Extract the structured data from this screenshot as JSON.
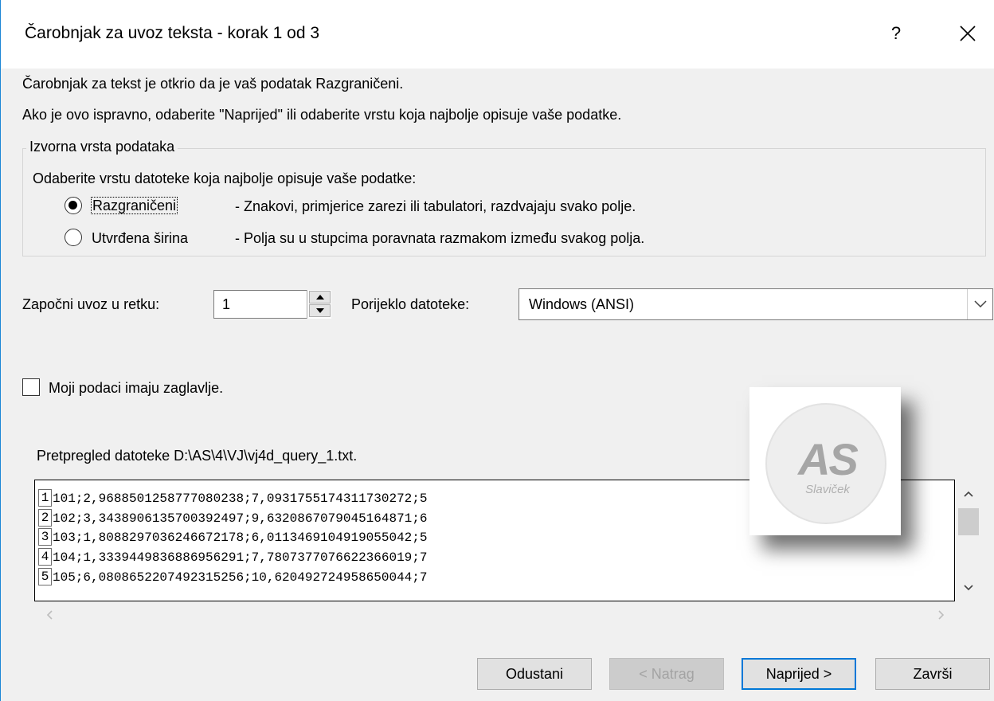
{
  "window": {
    "title": "Čarobnjak za uvoz teksta - korak 1 od 3",
    "help_label": "?"
  },
  "intro": {
    "line1": "Čarobnjak za tekst je otkrio da je vaš podatak Razgraničeni.",
    "line2": "Ako je ovo ispravno, odaberite \"Naprijed\" ili odaberite vrstu koja najbolje opisuje vaše podatke."
  },
  "source_type": {
    "legend": "Izvorna vrsta podataka",
    "prompt": "Odaberite vrstu datoteke koja najbolje opisuje vaše podatke:",
    "options": [
      {
        "label": "Razgraničeni",
        "description": "- Znakovi, primjerice zarezi ili tabulatori, razdvajaju svako polje.",
        "checked": true
      },
      {
        "label": "Utvrđena širina",
        "description": "- Polja su u stupcima poravnata razmakom između svakog polja.",
        "checked": false
      }
    ]
  },
  "start_row": {
    "label": "Započni uvoz u retku:",
    "value": "1"
  },
  "file_origin": {
    "label": "Porijeklo datoteke:",
    "value": "Windows (ANSI)"
  },
  "headers_checkbox": {
    "label": "Moji podaci imaju zaglavlje.",
    "checked": false
  },
  "preview": {
    "title": "Pretpregled datoteke D:\\AS\\4\\VJ\\vj4d_query_1.txt.",
    "rows": [
      {
        "num": "1",
        "text": "101;2,9688501258777080238;7,0931755174311730272;5"
      },
      {
        "num": "2",
        "text": "102;3,3438906135700392497;9,6320867079045164871;6"
      },
      {
        "num": "3",
        "text": "103;1,8088297036246672178;6,0113469104919055042;5"
      },
      {
        "num": "4",
        "text": "104;1,3339449836886956291;7,7807377076622366019;7"
      },
      {
        "num": "5",
        "text": "105;6,0808652207492315256;10,620492724958650044;7"
      }
    ]
  },
  "watermark": {
    "logo": "AS",
    "name": "Slaviček"
  },
  "buttons": {
    "cancel": "Odustani",
    "back": "< Natrag",
    "next": "Naprijed >",
    "finish": "Završi"
  },
  "colors": {
    "dialog_bg": "#f0f0f0",
    "accent": "#0078d7"
  }
}
